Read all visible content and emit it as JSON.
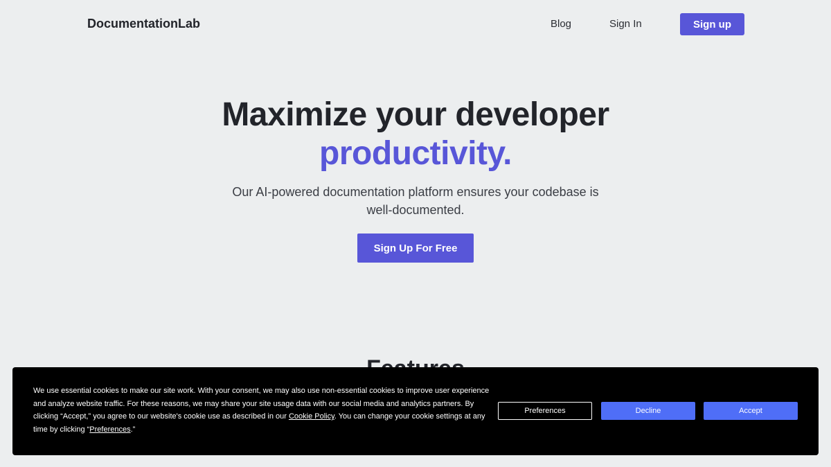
{
  "nav": {
    "brand": "DocumentationLab",
    "blog": "Blog",
    "sign_in": "Sign In",
    "sign_up": "Sign up"
  },
  "hero": {
    "title_line1": "Maximize your developer",
    "title_accent": "productivity.",
    "subtitle": "Our AI-powered documentation platform ensures your codebase is well-documented.",
    "cta": "Sign Up For Free"
  },
  "features": {
    "heading": "Features"
  },
  "cookie_banner": {
    "text_part1": "We use essential cookies to make our site work. With your consent, we may also use non-essential cookies to improve user experience and analyze website traffic. For these reasons, we may share your site usage data with our social media and analytics partners. By clicking “Accept,” you agree to our website's cookie use as described in our ",
    "cookie_policy_link": "Cookie Policy",
    "text_part2": ". You can change your cookie settings at any time by clicking “",
    "preferences_link": "Preferences",
    "text_part3": ".”",
    "preferences_button": "Preferences",
    "decline_button": "Decline",
    "accept_button": "Accept"
  },
  "colors": {
    "background": "#eceeef",
    "accent": "#5856d8",
    "banner_bg": "#000000",
    "banner_button": "#4f6ef7"
  }
}
